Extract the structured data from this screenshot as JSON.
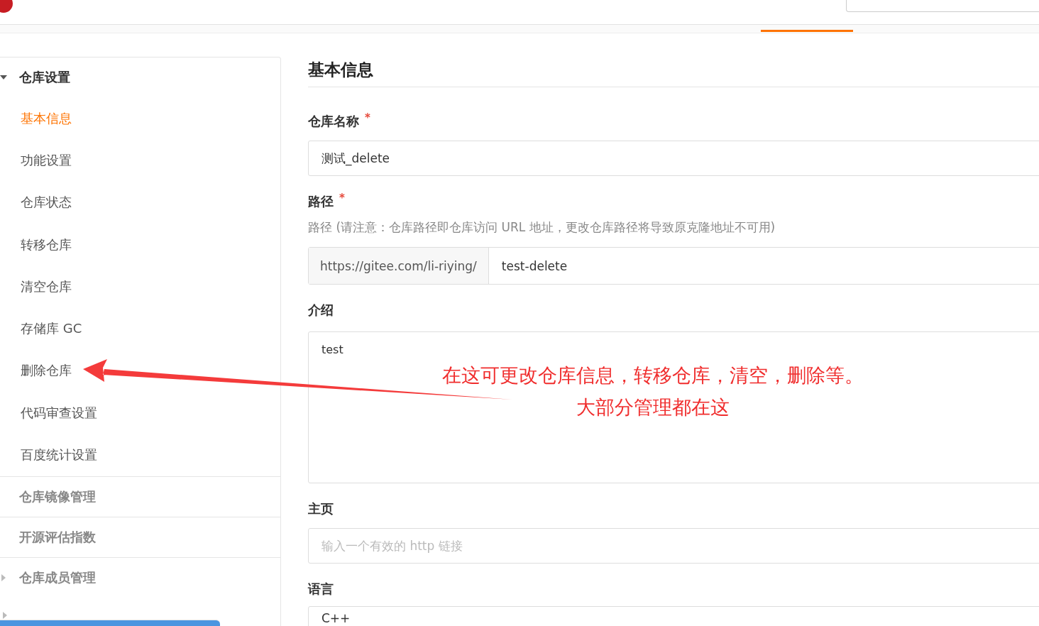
{
  "sidebar": {
    "groups": [
      {
        "label": "仓库设置",
        "kind": "tree",
        "expanded": true,
        "items": [
          {
            "label": "基本信息",
            "selected": true
          },
          {
            "label": "功能设置",
            "selected": false
          },
          {
            "label": "仓库状态",
            "selected": false
          },
          {
            "label": "转移仓库",
            "selected": false
          },
          {
            "label": "清空仓库",
            "selected": false
          },
          {
            "label": "存储库 GC",
            "selected": false
          },
          {
            "label": "删除仓库",
            "selected": false
          },
          {
            "label": "代码审查设置",
            "selected": false
          },
          {
            "label": "百度统计设置",
            "selected": false
          }
        ]
      },
      {
        "label": "仓库镜像管理",
        "kind": "plain"
      },
      {
        "label": "开源评估指数",
        "kind": "plain"
      },
      {
        "label": "仓库成员管理",
        "kind": "tree",
        "expanded": false
      }
    ]
  },
  "form": {
    "title": "基本信息",
    "fields": [
      {
        "kind": "text",
        "label": "仓库名称",
        "required_mark": "*",
        "value": "测试_delete"
      },
      {
        "kind": "path",
        "label": "路径",
        "required_mark": "*",
        "hint": "路径 (请注意：仓库路径即仓库访问 URL 地址，更改仓库路径将导致原克隆地址不可用)",
        "prefix": "https://gitee.com/li-riying/",
        "value": "test-delete"
      },
      {
        "kind": "textarea",
        "label": "介绍",
        "value": "test"
      },
      {
        "kind": "text",
        "label": "主页",
        "placeholder": "输入一个有效的 http 链接"
      },
      {
        "kind": "text",
        "label": "语言",
        "value": "C++"
      }
    ]
  },
  "annotation": {
    "lines": [
      "在这可更改仓库信息，转移仓库，清空，删除等。",
      "大部分管理都在这"
    ]
  }
}
